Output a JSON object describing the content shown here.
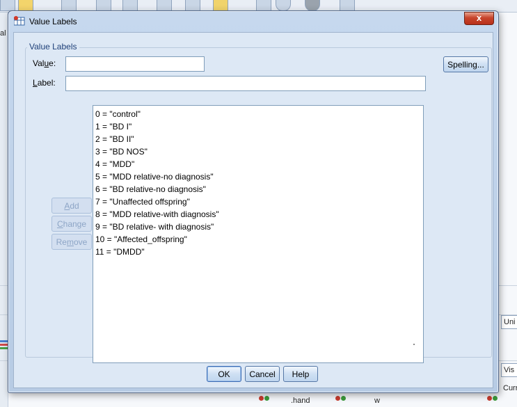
{
  "background": {
    "left_text": "al",
    "right_cells": [
      "Uni",
      "Vis",
      "Curr"
    ],
    "bottom_cells": [
      ".hand",
      "w"
    ]
  },
  "dialog": {
    "title": "Value Labels",
    "close_label": "x",
    "group_label": "Value Labels",
    "value_label": {
      "pre": "Val",
      "accel": "u",
      "post": "e:"
    },
    "label_label": {
      "pre": "",
      "accel": "L",
      "post": "abel:"
    },
    "value_field": {
      "value": "",
      "placeholder": ""
    },
    "label_field": {
      "value": "",
      "placeholder": ""
    },
    "spelling_label": "Spelling...",
    "add_label": {
      "pre": "",
      "accel": "A",
      "post": "dd"
    },
    "change_label": {
      "pre": "",
      "accel": "C",
      "post": "hange"
    },
    "remove_label": {
      "pre": "Re",
      "accel": "m",
      "post": "ove"
    },
    "labels": [
      "0 = \"control\"",
      "1 = \"BD I\"",
      "2 = \"BD II\"",
      "3 = \"BD NOS\"",
      "4 = \"MDD\"",
      "5 = \"MDD relative-no diagnosis\"",
      "6 = \"BD relative-no diagnosis\"",
      "7 = \"Unaffected offspring\"",
      "8 = \"MDD relative-with diagnosis\"",
      "9 = \"BD relative- with diagnosis\"",
      "10 = \"Affected_offspring\"",
      "11 = \"DMDD\""
    ],
    "ok_label": "OK",
    "cancel_label": "Cancel",
    "help_label": "Help"
  }
}
